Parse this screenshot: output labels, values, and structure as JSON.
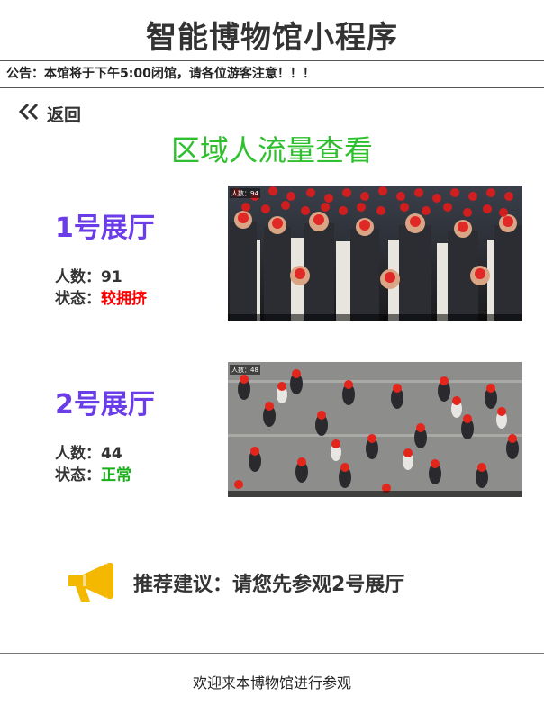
{
  "app": {
    "title": "智能博物馆小程序"
  },
  "notice": {
    "text": "公告：本馆将于下午5:00闭馆，请各位游客注意！！！"
  },
  "nav": {
    "back_label": "返回",
    "back_icon": "double-chevron-left-icon"
  },
  "page": {
    "section_title": "区域人流量查看"
  },
  "halls": [
    {
      "name": "1号展厅",
      "count_label": "人数：",
      "count": "91",
      "status_label": "状态：",
      "status": "较拥挤",
      "status_color": "#ff0000",
      "image_overlay": "人数：94"
    },
    {
      "name": "2号展厅",
      "count_label": "人数：",
      "count": "44",
      "status_label": "状态：",
      "status": "正常",
      "status_color": "#19b019",
      "image_overlay": "人数：48"
    }
  ],
  "recommendation": {
    "icon": "megaphone-icon",
    "text": "推荐建议：请您先参观2号展厅"
  },
  "footer": {
    "text": "欢迎来本博物馆进行参观"
  },
  "colors": {
    "accent_green": "#2ec02e",
    "hall_name_purple": "#6a3de8",
    "megaphone_yellow": "#f5b800"
  }
}
